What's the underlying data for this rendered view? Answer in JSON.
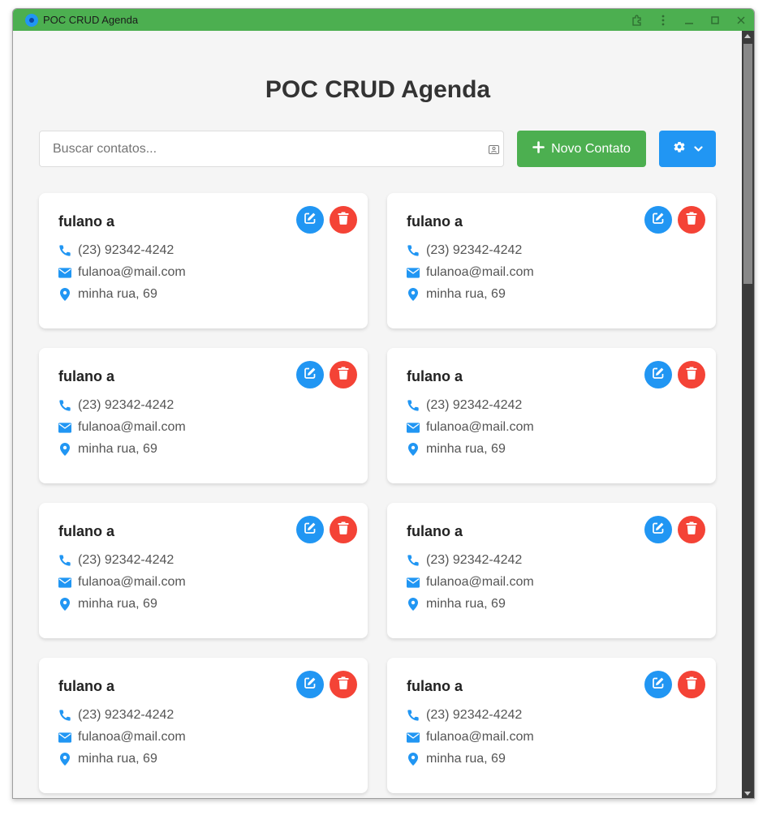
{
  "window": {
    "title": "POC CRUD Agenda"
  },
  "page": {
    "title": "POC CRUD Agenda"
  },
  "search": {
    "placeholder": "Buscar contatos...",
    "value": ""
  },
  "toolbar": {
    "new_contact_label": "Novo Contato"
  },
  "colors": {
    "titlebar": "#4caf50",
    "primary": "#2196f3",
    "success": "#4caf50",
    "danger": "#f44336"
  },
  "contacts": [
    {
      "name": "fulano a",
      "phone": "(23) 92342-4242",
      "email": "fulanoa@mail.com",
      "address": "minha rua, 69"
    },
    {
      "name": "fulano a",
      "phone": "(23) 92342-4242",
      "email": "fulanoa@mail.com",
      "address": "minha rua, 69"
    },
    {
      "name": "fulano a",
      "phone": "(23) 92342-4242",
      "email": "fulanoa@mail.com",
      "address": "minha rua, 69"
    },
    {
      "name": "fulano a",
      "phone": "(23) 92342-4242",
      "email": "fulanoa@mail.com",
      "address": "minha rua, 69"
    },
    {
      "name": "fulano a",
      "phone": "(23) 92342-4242",
      "email": "fulanoa@mail.com",
      "address": "minha rua, 69"
    },
    {
      "name": "fulano a",
      "phone": "(23) 92342-4242",
      "email": "fulanoa@mail.com",
      "address": "minha rua, 69"
    },
    {
      "name": "fulano a",
      "phone": "(23) 92342-4242",
      "email": "fulanoa@mail.com",
      "address": "minha rua, 69"
    },
    {
      "name": "fulano a",
      "phone": "(23) 92342-4242",
      "email": "fulanoa@mail.com",
      "address": "minha rua, 69"
    }
  ],
  "icons": {
    "phone": "phone-icon",
    "email": "envelope-icon",
    "address": "map-marker-icon",
    "edit": "edit-icon",
    "delete": "trash-icon",
    "add": "plus-icon",
    "settings": "gear-icon"
  }
}
